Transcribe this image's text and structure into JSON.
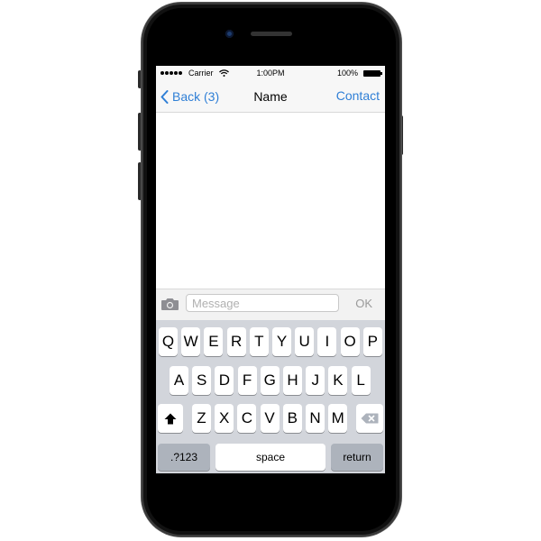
{
  "status_bar": {
    "carrier": "Carrier",
    "time": "1:00PM",
    "battery": "100%"
  },
  "nav": {
    "back_label": "Back (3)",
    "title": "Name",
    "right_label": "Contact"
  },
  "input_bar": {
    "placeholder": "Message",
    "ok_label": "OK"
  },
  "keyboard": {
    "row1": [
      "Q",
      "W",
      "E",
      "R",
      "T",
      "Y",
      "U",
      "I",
      "O",
      "P"
    ],
    "row2": [
      "A",
      "S",
      "D",
      "F",
      "G",
      "H",
      "J",
      "K",
      "L"
    ],
    "row3": [
      "Z",
      "X",
      "C",
      "V",
      "B",
      "N",
      "M"
    ],
    "numbers_label": ".?123",
    "space_label": "space",
    "return_label": "return"
  },
  "colors": {
    "accent": "#2f7fd6",
    "keyboard_bg": "#d2d5db",
    "dark_key": "#adb3bc"
  },
  "icons": {
    "back": "chevron-left-icon",
    "camera": "camera-icon",
    "shift": "shift-arrow-icon",
    "delete": "backspace-icon",
    "wifi": "wifi-icon",
    "battery": "battery-icon"
  }
}
